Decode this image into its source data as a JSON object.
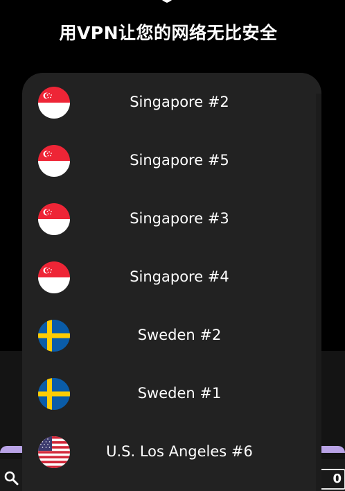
{
  "header": {
    "title": "用VPN让您的网络无比安全",
    "icon": "shield-icon"
  },
  "servers": [
    {
      "label": "Singapore #2",
      "flag": "singapore"
    },
    {
      "label": "Singapore #5",
      "flag": "singapore"
    },
    {
      "label": "Singapore #3",
      "flag": "singapore"
    },
    {
      "label": "Singapore #4",
      "flag": "singapore"
    },
    {
      "label": "Sweden #2",
      "flag": "sweden"
    },
    {
      "label": "Sweden #1",
      "flag": "sweden"
    },
    {
      "label": "U.S. Los Angeles #6",
      "flag": "usa"
    }
  ],
  "bottom": {
    "search_icon": "search-icon",
    "counter_text": "0"
  },
  "colors": {
    "background": "#000000",
    "panel": "#222222",
    "accent": "#b9a3e6",
    "text": "#ffffff"
  }
}
